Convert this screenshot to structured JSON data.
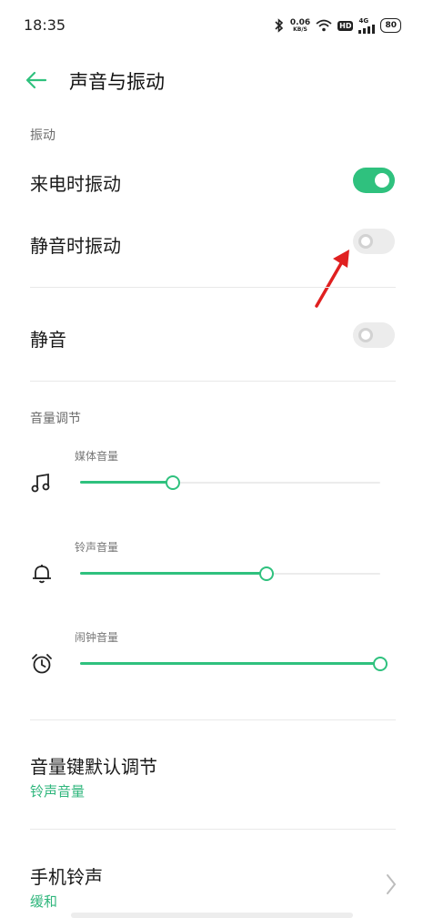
{
  "status_bar": {
    "time": "18:35",
    "speed_value": "0.06",
    "speed_unit": "KB/S",
    "hd": "HD",
    "signal": "4G",
    "battery": "80"
  },
  "header": {
    "title": "声音与振动"
  },
  "vibration": {
    "section_label": "振动",
    "items": [
      {
        "label": "来电时振动",
        "enabled": true
      },
      {
        "label": "静音时振动",
        "enabled": false
      }
    ]
  },
  "mute": {
    "label": "静音",
    "enabled": false
  },
  "volume": {
    "section_label": "音量调节",
    "sliders": [
      {
        "label": "媒体音量",
        "icon": "music-note-icon",
        "level": 0.31
      },
      {
        "label": "铃声音量",
        "icon": "bell-icon",
        "level": 0.62
      },
      {
        "label": "闹钟音量",
        "icon": "alarm-clock-icon",
        "level": 1.0
      }
    ]
  },
  "volume_key": {
    "label": "音量键默认调节",
    "value": "铃声音量"
  },
  "ringtone": {
    "label": "手机铃声",
    "value": "缓和"
  },
  "colors": {
    "accent": "#2fc17e",
    "arrow": "#e02020"
  }
}
